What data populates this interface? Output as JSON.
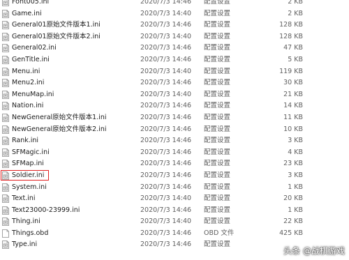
{
  "files": [
    {
      "name": "Font005.ini",
      "date": "2020/7/3 14:46",
      "type": "配置设置",
      "size": "2 KB",
      "icon": "ini-file-icon"
    },
    {
      "name": "Game.ini",
      "date": "2020/7/3 14:40",
      "type": "配置设置",
      "size": "2 KB",
      "icon": "ini-file-icon"
    },
    {
      "name": "General01原始文件版本1.ini",
      "date": "2020/7/3 14:46",
      "type": "配置设置",
      "size": "128 KB",
      "icon": "ini-file-icon"
    },
    {
      "name": "General01原始文件版本2.ini",
      "date": "2020/7/3 14:40",
      "type": "配置设置",
      "size": "128 KB",
      "icon": "ini-file-icon"
    },
    {
      "name": "General02.ini",
      "date": "2020/7/3 14:46",
      "type": "配置设置",
      "size": "47 KB",
      "icon": "ini-file-icon"
    },
    {
      "name": "GenTitle.ini",
      "date": "2020/7/3 14:46",
      "type": "配置设置",
      "size": "5 KB",
      "icon": "ini-file-icon"
    },
    {
      "name": "Menu.ini",
      "date": "2020/7/3 14:40",
      "type": "配置设置",
      "size": "119 KB",
      "icon": "ini-file-icon"
    },
    {
      "name": "Menu2.ini",
      "date": "2020/7/3 14:46",
      "type": "配置设置",
      "size": "30 KB",
      "icon": "ini-file-icon"
    },
    {
      "name": "MenuMap.ini",
      "date": "2020/7/3 14:40",
      "type": "配置设置",
      "size": "21 KB",
      "icon": "ini-file-icon"
    },
    {
      "name": "Nation.ini",
      "date": "2020/7/3 14:46",
      "type": "配置设置",
      "size": "14 KB",
      "icon": "ini-file-icon"
    },
    {
      "name": "NewGeneral原始文件版本1.ini",
      "date": "2020/7/3 14:46",
      "type": "配置设置",
      "size": "11 KB",
      "icon": "ini-file-icon"
    },
    {
      "name": "NewGeneral原始文件版本2.ini",
      "date": "2020/7/3 14:46",
      "type": "配置设置",
      "size": "10 KB",
      "icon": "ini-file-icon"
    },
    {
      "name": "Rank.ini",
      "date": "2020/7/3 14:46",
      "type": "配置设置",
      "size": "3 KB",
      "icon": "ini-file-icon"
    },
    {
      "name": "SFMagic.ini",
      "date": "2020/7/3 14:46",
      "type": "配置设置",
      "size": "4 KB",
      "icon": "ini-file-icon"
    },
    {
      "name": "SFMap.ini",
      "date": "2020/7/3 14:46",
      "type": "配置设置",
      "size": "23 KB",
      "icon": "ini-file-icon"
    },
    {
      "name": "Soldier.ini",
      "date": "2020/7/3 14:46",
      "type": "配置设置",
      "size": "3 KB",
      "icon": "ini-file-icon",
      "highlighted": true
    },
    {
      "name": "System.ini",
      "date": "2020/7/3 14:46",
      "type": "配置设置",
      "size": "1 KB",
      "icon": "ini-file-icon"
    },
    {
      "name": "Text.ini",
      "date": "2020/7/3 14:40",
      "type": "配置设置",
      "size": "20 KB",
      "icon": "ini-file-icon"
    },
    {
      "name": "Text23000-23999.ini",
      "date": "2020/7/3 14:46",
      "type": "配置设置",
      "size": "1 KB",
      "icon": "ini-file-icon"
    },
    {
      "name": "Thing.ini",
      "date": "2020/7/3 14:40",
      "type": "配置设置",
      "size": "22 KB",
      "icon": "ini-file-icon"
    },
    {
      "name": "Things.obd",
      "date": "2020/7/3 14:46",
      "type": "OBD 文件",
      "size": "425 KB",
      "icon": "blank-file-icon"
    },
    {
      "name": "Type.ini",
      "date": "2020/7/3 14:46",
      "type": "配置设置",
      "size": "",
      "icon": "ini-file-icon"
    }
  ],
  "watermark": "头条 @战棋游戏",
  "colors": {
    "highlight_border": "#e02020",
    "secondary_text": "#5f5f5f"
  }
}
